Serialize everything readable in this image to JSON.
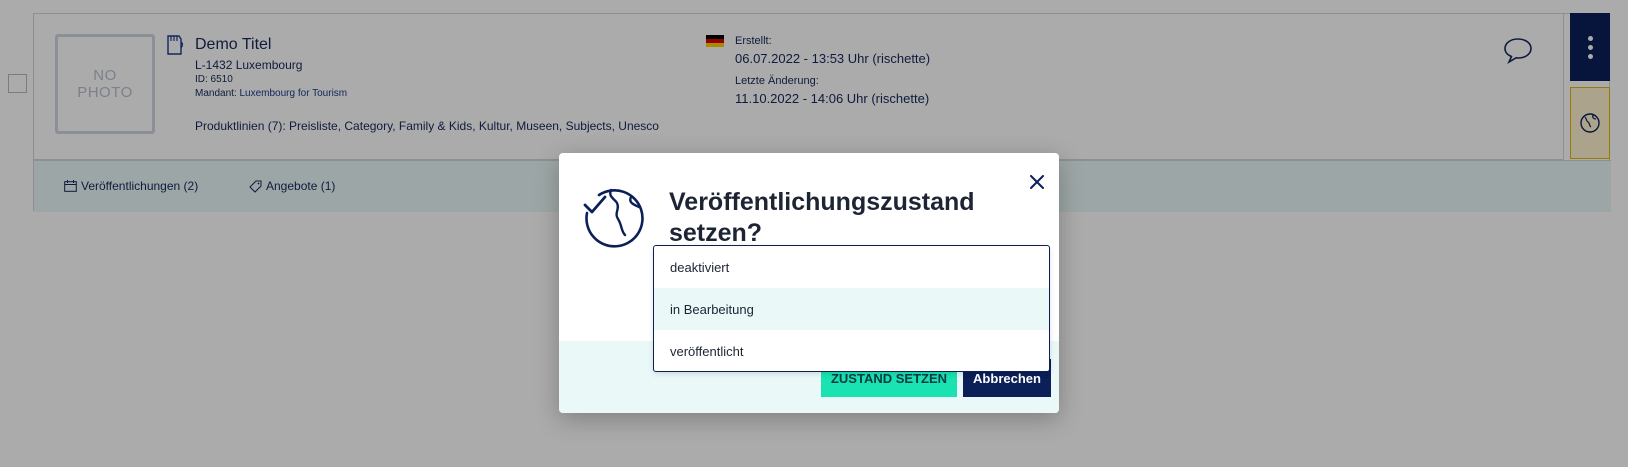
{
  "card": {
    "photo_placeholder": "NO\nPHOTO",
    "title": "Demo Titel",
    "address": "L-1432 Luxembourg",
    "id_line": "ID: 6510",
    "mandant_label": "Mandant:",
    "mandant_value": "Luxembourg for Tourism",
    "product_lines": "Produktlinien (7): Preisliste, Category, Family & Kids, Kultur, Museen, Subjects, Unesco",
    "created_label": "Erstellt:",
    "created_value": "06.07.2022 - 13:53 Uhr (rischette)",
    "changed_label": "Letzte Änderung:",
    "changed_value": "11.10.2022 - 14:06 Uhr (rischette)",
    "flag_colors": [
      "#000000",
      "#dd0000",
      "#ffce00"
    ]
  },
  "tabs": {
    "publications": "Veröffentlichungen (2)",
    "offers": "Angebote (1)"
  },
  "modal": {
    "title": "Veröffentlichungszustand setzen?",
    "confirm_label": "ZUSTAND SETZEN",
    "cancel_label": "Abbrechen"
  },
  "dropdown": {
    "options": [
      "deaktiviert",
      "in Bearbeitung",
      "veröffentlicht"
    ],
    "highlighted": "in Bearbeitung"
  },
  "colors": {
    "navy": "#0b1f58",
    "accent_green": "#19e3b0",
    "light_teal": "#eaf8f8",
    "warning_yellow": "#e8b400"
  }
}
